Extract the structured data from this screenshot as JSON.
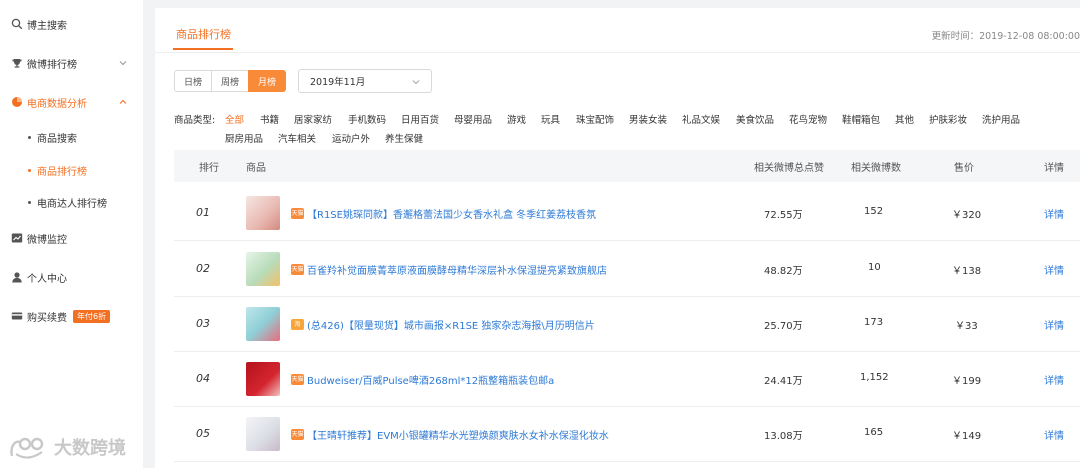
{
  "sidebar": {
    "items": [
      {
        "label": "博主搜索",
        "icon": "search-icon"
      },
      {
        "label": "微博排行榜",
        "icon": "trophy-icon"
      },
      {
        "label": "电商数据分析",
        "icon": "pie-chart-icon"
      },
      {
        "label": "微博监控",
        "icon": "chart-icon"
      },
      {
        "label": "个人中心",
        "icon": "user-icon"
      },
      {
        "label": "购买续费",
        "icon": "card-icon",
        "badge": "年付6折"
      }
    ],
    "subitems": [
      {
        "label": "商品搜索"
      },
      {
        "label": "商品排行榜"
      },
      {
        "label": "电商达人排行榜"
      }
    ]
  },
  "watermark": "大数跨境",
  "header": {
    "tab": "商品排行榜",
    "updated": "更新时间：2019-12-08 08:00:00"
  },
  "filters": {
    "periods": [
      "日榜",
      "周榜",
      "月榜"
    ],
    "active_period": "月榜",
    "month": "2019年11月"
  },
  "categories": {
    "label": "商品类型:",
    "items": [
      "全部",
      "书籍",
      "居家家纺",
      "手机数码",
      "日用百货",
      "母婴用品",
      "游戏",
      "玩具",
      "珠宝配饰",
      "男装女装",
      "礼品文娱",
      "美食饮品",
      "花鸟宠物",
      "鞋帽箱包",
      "其他",
      "护肤彩妆",
      "洗护用品",
      "厨房用品",
      "汽车相关",
      "运动户外",
      "养生保健"
    ],
    "active": "全部"
  },
  "table": {
    "headers": [
      "排行",
      "商品",
      "相关微博总点赞",
      "相关微博数",
      "售价",
      "详情"
    ],
    "rows": [
      {
        "rank": "01",
        "tag": "天猫",
        "title": "【R1SE姚琛同款】香邂格蕾法国少女香水礼盒 冬季红姜荔枝香氛",
        "likes": "72.55万",
        "posts": "152",
        "price": "￥320",
        "detail": "详情"
      },
      {
        "rank": "02",
        "tag": "天猫",
        "title": "百雀羚补觉面膜菁萃原液面膜酵母精华深层补水保湿提亮紧致旗舰店",
        "likes": "48.82万",
        "posts": "10",
        "price": "￥138",
        "detail": "详情"
      },
      {
        "rank": "03",
        "tag": "淘",
        "title": "(总426)【限量现货】城市画报×R1SE 独家杂志海报\\月历明信片",
        "likes": "25.70万",
        "posts": "173",
        "price": "￥33",
        "detail": "详情"
      },
      {
        "rank": "04",
        "tag": "天猫",
        "title": "Budweiser/百威Pulse啤酒268ml*12瓶整箱瓶装包邮a",
        "likes": "24.41万",
        "posts": "1,152",
        "price": "￥199",
        "detail": "详情"
      },
      {
        "rank": "05",
        "tag": "天猫",
        "title": "【王晴轩推荐】EVM小银罐精华水光塑焕颜爽肤水女补水保湿化妆水",
        "likes": "13.08万",
        "posts": "165",
        "price": "￥149",
        "detail": "详情"
      }
    ]
  },
  "colors": {
    "accent": "#f36f21",
    "link": "#2d7ad6"
  }
}
